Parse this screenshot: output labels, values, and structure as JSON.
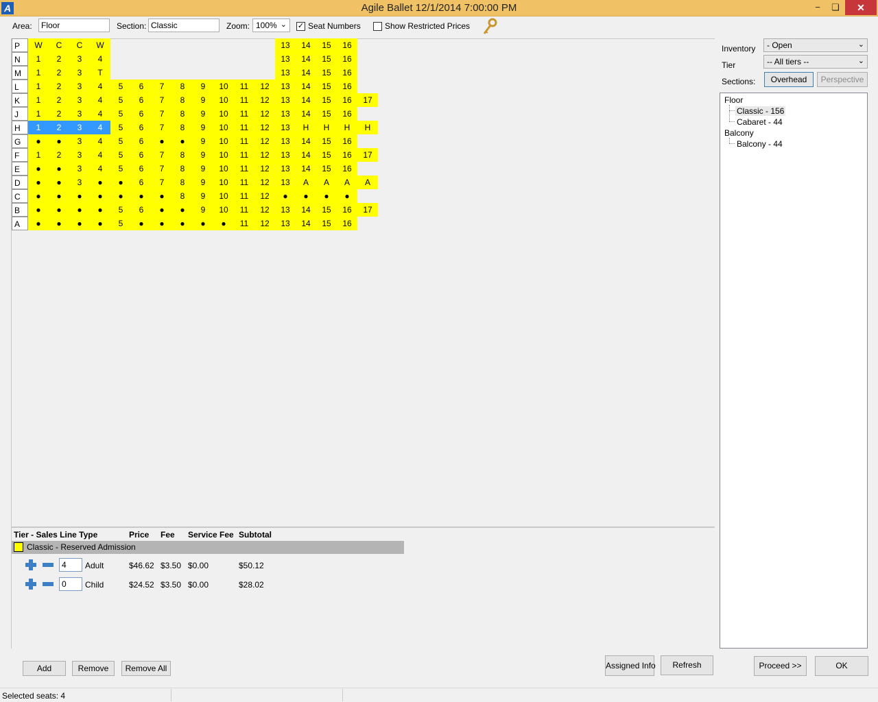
{
  "window": {
    "title": "Agile Ballet 12/1/2014 7:00:00 PM",
    "app_icon": "A",
    "minimize": "−",
    "maximize": "❏",
    "close": "✕"
  },
  "toolbar": {
    "area_label": "Area:",
    "area_value": "Floor",
    "section_label": "Section:",
    "section_value": "Classic",
    "zoom_label": "Zoom:",
    "zoom_value": "100%",
    "seat_numbers_label": "Seat Numbers",
    "seat_numbers_checked": true,
    "restricted_label": "Show Restricted Prices",
    "restricted_checked": false,
    "key_icon": "key-icon"
  },
  "seat_map": {
    "rows": [
      {
        "label": "P",
        "seats": [
          [
            "W",
            0
          ],
          [
            "C",
            0
          ],
          [
            "C",
            0
          ],
          [
            "W",
            0
          ],
          [
            "13",
            12
          ],
          [
            "14",
            12
          ],
          [
            "15",
            12
          ],
          [
            "16",
            12
          ]
        ]
      },
      {
        "label": "N",
        "seats": [
          [
            "1",
            0
          ],
          [
            "2",
            0
          ],
          [
            "3",
            0
          ],
          [
            "4",
            0
          ],
          [
            "13",
            12
          ],
          [
            "14",
            12
          ],
          [
            "15",
            12
          ],
          [
            "16",
            12
          ]
        ]
      },
      {
        "label": "M",
        "seats": [
          [
            "1",
            0
          ],
          [
            "2",
            0
          ],
          [
            "3",
            0
          ],
          [
            "T",
            0
          ],
          [
            "13",
            12
          ],
          [
            "14",
            12
          ],
          [
            "15",
            12
          ],
          [
            "16",
            12
          ]
        ]
      },
      {
        "label": "L",
        "seats": [
          "1",
          "2",
          "3",
          "4",
          "5",
          "6",
          "7",
          "8",
          "9",
          "10",
          "11",
          "12",
          "13",
          "14",
          "15",
          "16"
        ]
      },
      {
        "label": "K",
        "seats": [
          "1",
          "2",
          "3",
          "4",
          "5",
          "6",
          "7",
          "8",
          "9",
          "10",
          "11",
          "12",
          "13",
          "14",
          "15",
          "16",
          "17"
        ]
      },
      {
        "label": "J",
        "seats": [
          "1",
          "2",
          "3",
          "4",
          "5",
          "6",
          "7",
          "8",
          "9",
          "10",
          "11",
          "12",
          "13",
          "14",
          "15",
          "16"
        ]
      },
      {
        "label": "H",
        "seats": [
          "1",
          "2",
          "3",
          "4",
          "5",
          "6",
          "7",
          "8",
          "9",
          "10",
          "11",
          "12",
          "13",
          "H",
          "H",
          "H",
          "H"
        ],
        "selected": [
          0,
          1,
          2,
          3
        ]
      },
      {
        "label": "G",
        "seats": [
          "●",
          "●",
          "3",
          "4",
          "5",
          "6",
          "●",
          "●",
          "9",
          "10",
          "11",
          "12",
          "13",
          "14",
          "15",
          "16"
        ]
      },
      {
        "label": "F",
        "seats": [
          "1",
          "2",
          "3",
          "4",
          "5",
          "6",
          "7",
          "8",
          "9",
          "10",
          "11",
          "12",
          "13",
          "14",
          "15",
          "16",
          "17"
        ]
      },
      {
        "label": "E",
        "seats": [
          "●",
          "●",
          "3",
          "4",
          "5",
          "6",
          "7",
          "8",
          "9",
          "10",
          "11",
          "12",
          "13",
          "14",
          "15",
          "16"
        ]
      },
      {
        "label": "D",
        "seats": [
          "●",
          "●",
          "3",
          "●",
          "●",
          "6",
          "7",
          "8",
          "9",
          "10",
          "11",
          "12",
          "13",
          "A",
          "A",
          "A",
          "A"
        ]
      },
      {
        "label": "C",
        "seats": [
          "●",
          "●",
          "●",
          "●",
          "●",
          "●",
          "●",
          "8",
          "9",
          "10",
          "11",
          "12",
          "●",
          "●",
          "●",
          "●"
        ]
      },
      {
        "label": "B",
        "seats": [
          "●",
          "●",
          "●",
          "●",
          "5",
          "6",
          "●",
          "●",
          "9",
          "10",
          "11",
          "12",
          "13",
          "14",
          "15",
          "16",
          "17"
        ]
      },
      {
        "label": "A",
        "seats": [
          "●",
          "●",
          "●",
          "●",
          "5",
          "●",
          "●",
          "●",
          "●",
          "●",
          "11",
          "12",
          "13",
          "14",
          "15",
          "16"
        ]
      }
    ]
  },
  "right_panel": {
    "inventory_label": "Inventory",
    "inventory_value": "- Open",
    "tier_label": "Tier",
    "tier_value": "-- All tiers --",
    "sections_label": "Sections:",
    "overhead_label": "Overhead",
    "perspective_label": "Perspective",
    "tree": {
      "floor": "Floor",
      "classic": "Classic - 156",
      "cabaret": "Cabaret - 44",
      "balcony": "Balcony",
      "balcony_child": "Balcony - 44"
    }
  },
  "sales": {
    "headers": {
      "tier": "Tier - Sales Line Type",
      "price": "Price",
      "fee": "Fee",
      "service_fee": "Service Fee",
      "subtotal": "Subtotal"
    },
    "tier_name": "Classic - Reserved Admission",
    "tier_color": "#ffff00",
    "lines": [
      {
        "qty": "4",
        "type": "Adult",
        "price": "$46.62",
        "fee": "$3.50",
        "service_fee": "$0.00",
        "subtotal": "$50.12"
      },
      {
        "qty": "0",
        "type": "Child",
        "price": "$24.52",
        "fee": "$3.50",
        "service_fee": "$0.00",
        "subtotal": "$28.02"
      }
    ]
  },
  "buttons": {
    "add": "Add",
    "remove": "Remove",
    "remove_all": "Remove All",
    "assigned_info": "Assigned Info",
    "refresh": "Refresh",
    "proceed": "Proceed >>",
    "ok": "OK"
  },
  "status": {
    "selected_seats": "Selected seats:  4"
  }
}
